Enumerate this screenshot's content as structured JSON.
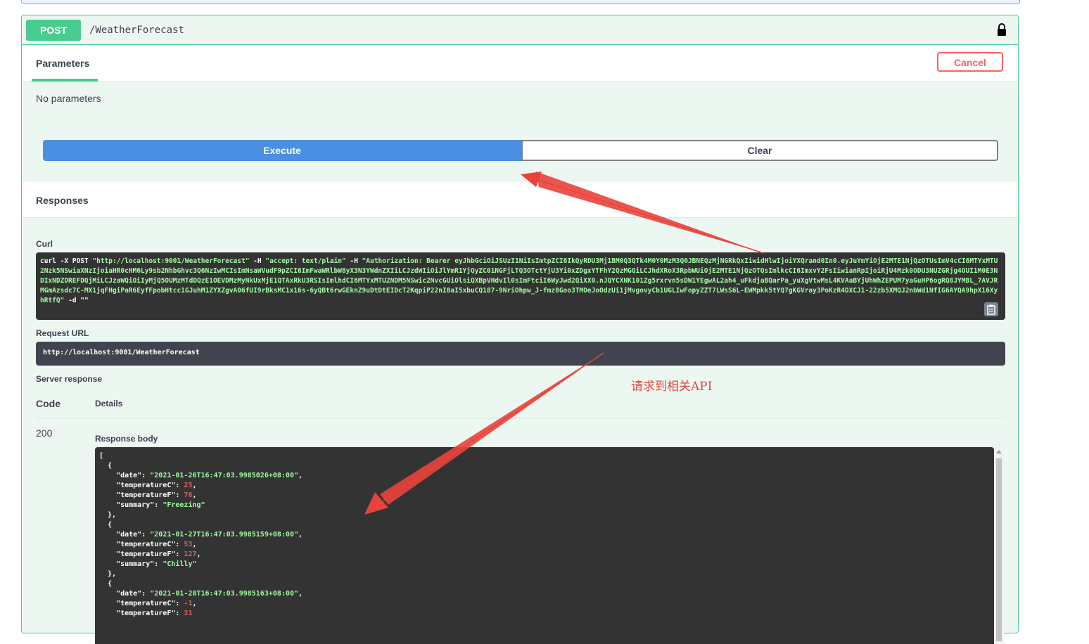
{
  "operation": {
    "method": "POST",
    "path": "/WeatherForecast"
  },
  "parameters": {
    "tab_label": "Parameters",
    "cancel_label": "Cancel",
    "empty_text": "No parameters"
  },
  "actions": {
    "execute_label": "Execute",
    "clear_label": "Clear"
  },
  "responses": {
    "title": "Responses",
    "curl_label": "Curl",
    "curl_command_prefix": "curl -X POST",
    "curl_url": "\"http://localhost:9001/WeatherForecast\"",
    "curl_h1_flag": "-H",
    "curl_h1": "\"accept: text/plain\"",
    "curl_h2_flag": "-H",
    "curl_h2": "\"Authorization: Bearer eyJhbGciOiJSUzI1NiIsImtpZCI6IkQyRDU3Mj1BM0Q3QTk4M0Y0MzM3Q0JBNEQzMjNGRkQxIiwidHlwIjoiYXQrand0In0.eyJuYmYiOjE2MTE1NjQzOTUsImV4cCI6MTYxMTU2Nzk5NSwiaXNzIjoiaHR0cHM6Ly9sb2NhbGhvc3Q6NzIwMCIsImNsaWVudF9pZCI6ImFwaWRlbW8yX3N3YWdnZXIiLCJzdWIiOiJlYmR1YjQyZC01NGFjLTQ3OTctYjU3Yi0xZDgxYTFhY2QzMGQiLCJhdXRoX3RpbWUiOjE2MTE1NjQzOTQsImlkcCI6ImxvY2FsIiwianRpIjoiRjU4Mzk0ODU3NUZGRjg4OUI1M0E3NDIxNDZDREFDQjMiLCJzaWQiOiIyMjQ5OUMzMTdDQzE1OEVDMzMyNkUxMjE1QTAxRkU3RSIsImlhdCI6MTYxMTU2NDM5NSwic2NvcGUiOlsiQXBpVHdvIl0sImFtciI6WyJwd2QiXX0.nJQYCXNK101Zg5rxrvn5sDW1YEgwAL2ah4_uFkdjaBQarPa_yuXgVtwMsL4KVAaBYjUhWhZEPUM7yaGuHP6ogRQ8JYMBL_7AVJRMGmAzsdc7C-MX1jqFHgiPaR6EyfFpobHtcc1GJuhM1ZYXZgvA06fUI9rBksMC1x16s-6yQBt6rwGEknZ9uDtDtEIDcT2KqpiP22nI8aI5xbuCQ187-9NriOhpw_J-fmz8Goo3TMOeJoOdzUi1jMvgovyCb1UGLIwFopyZZT7LWsS6L-EWMpkk5tYQ7gKGVray3PoKzR4DXCJ1-22zb5XMQJ2nbWd1NfIG6AYQA9hpX16XyhRtfQ\"",
    "curl_d": "-d \"\"",
    "request_url_label": "Request URL",
    "request_url": "http://localhost:9001/WeatherForecast",
    "server_response_label": "Server response",
    "code_header": "Code",
    "details_header": "Details",
    "status_code": "200",
    "response_body_label": "Response body",
    "body": [
      {
        "date": "2021-01-26T16:47:03.9985026+08:00",
        "temperatureC": "25",
        "temperatureF": "76",
        "summary": "Freezing"
      },
      {
        "date": "2021-01-27T16:47:03.9985159+08:00",
        "temperatureC": "53",
        "temperatureF": "127",
        "summary": "Chilly"
      },
      {
        "date": "2021-01-28T16:47:03.9985163+08:00",
        "temperatureC": "-1",
        "temperatureF": "31"
      }
    ]
  },
  "annotation": {
    "text": "请求到相关API",
    "color": "#e8423a"
  },
  "colors": {
    "post": "#49cc90",
    "execute": "#4990e2",
    "cancel": "#ff6060",
    "code_bg": "#333333",
    "string": "#a2fca2",
    "number": "#d36363"
  }
}
